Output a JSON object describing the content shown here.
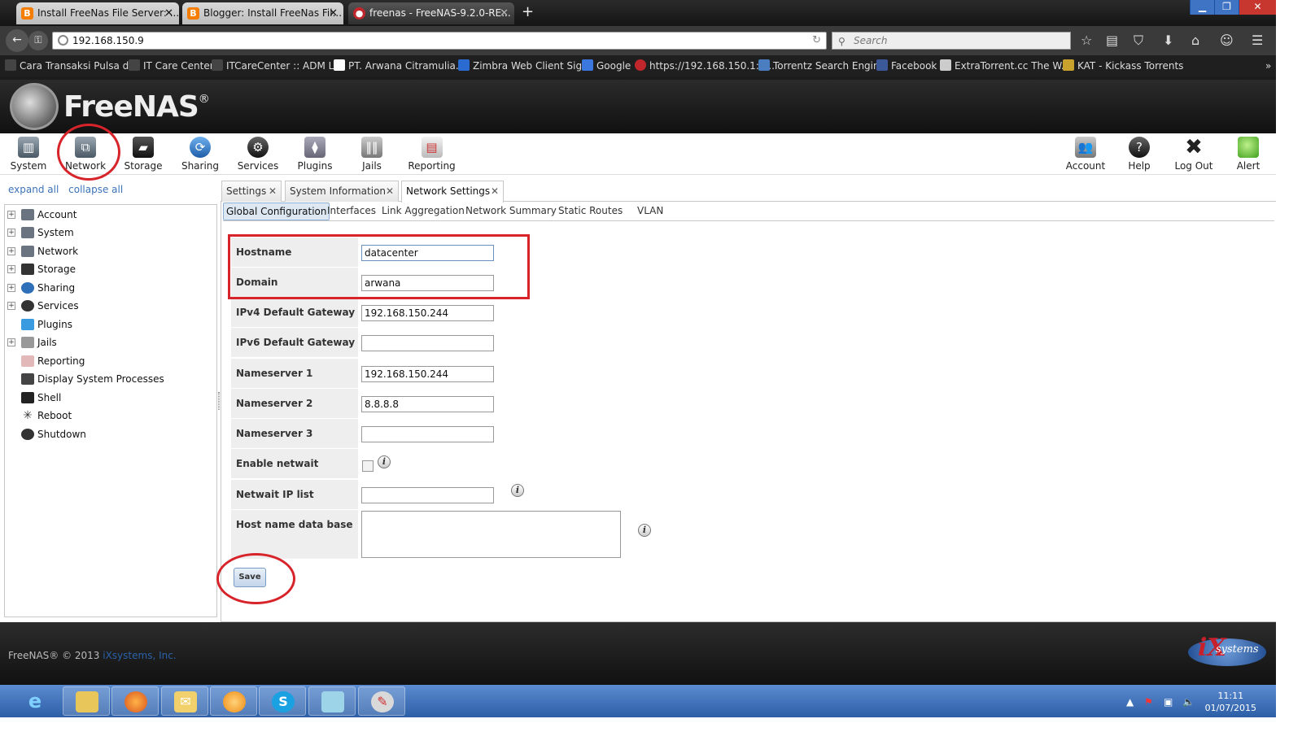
{
  "browser": {
    "tabs": [
      {
        "label": "Install FreeNas File Server: ...",
        "favicon": "B"
      },
      {
        "label": "Blogger: Install FreeNas Fil...",
        "favicon": "B"
      },
      {
        "label": "freenas - FreeNAS-9.2.0-RE...",
        "favicon": "●"
      }
    ],
    "url": "192.168.150.9",
    "search_placeholder": "Search",
    "bookmarks": [
      "Cara Transaksi Pulsa di...",
      "IT Care Center",
      "ITCareCenter :: ADM L...",
      "PT. Arwana Citramulia...",
      "Zimbra Web Client Sig...",
      "Google",
      "https://192.168.150.1:3...",
      "Torrentz Search Engine",
      "Facebook",
      "ExtraTorrent.cc The W...",
      "KAT - Kickass Torrents"
    ]
  },
  "app": {
    "logo_text": "FreeNAS",
    "logo_mark": "®"
  },
  "toolbar": {
    "left": [
      "System",
      "Network",
      "Storage",
      "Sharing",
      "Services",
      "Plugins",
      "Jails",
      "Reporting"
    ],
    "right": [
      "Account",
      "Help",
      "Log Out",
      "Alert"
    ]
  },
  "tree": {
    "expand_all": "expand all",
    "collapse_all": "collapse all",
    "items": [
      {
        "label": "Account",
        "expandable": true
      },
      {
        "label": "System",
        "expandable": true
      },
      {
        "label": "Network",
        "expandable": true
      },
      {
        "label": "Storage",
        "expandable": true
      },
      {
        "label": "Sharing",
        "expandable": true
      },
      {
        "label": "Services",
        "expandable": true
      },
      {
        "label": "Plugins",
        "expandable": false
      },
      {
        "label": "Jails",
        "expandable": true
      },
      {
        "label": "Reporting",
        "expandable": false
      },
      {
        "label": "Display System Processes",
        "expandable": false
      },
      {
        "label": "Shell",
        "expandable": false
      },
      {
        "label": "Reboot",
        "expandable": false
      },
      {
        "label": "Shutdown",
        "expandable": false
      }
    ]
  },
  "content_tabs": [
    "Settings",
    "System Information",
    "Network Settings"
  ],
  "active_content_tab": "Network Settings",
  "subtabs": [
    "Global Configuration",
    "Interfaces",
    "Link Aggregation",
    "Network Summary",
    "Static Routes",
    "VLAN"
  ],
  "active_subtab": "Global Configuration",
  "form": {
    "hostname_label": "Hostname",
    "hostname_value": "datacenter",
    "domain_label": "Domain",
    "domain_value": "arwana",
    "ipv4_gateway_label": "IPv4 Default Gateway",
    "ipv4_gateway_value": "192.168.150.244",
    "ipv6_gateway_label": "IPv6 Default Gateway",
    "ipv6_gateway_value": "",
    "ns1_label": "Nameserver 1",
    "ns1_value": "192.168.150.244",
    "ns2_label": "Nameserver 2",
    "ns2_value": "8.8.8.8",
    "ns3_label": "Nameserver 3",
    "ns3_value": "",
    "netwait_enable_label": "Enable netwait feature",
    "netwait_enable_checked": false,
    "netwait_ip_label": "Netwait IP list",
    "netwait_ip_value": "",
    "hostdb_label": "Host name data base",
    "hostdb_value": "",
    "save_label": "Save"
  },
  "footer": {
    "copyright": "FreeNAS® © 2013 ",
    "company_link": "iXsystems, Inc.",
    "ix_logo_text": "systems",
    "ix_logo_mark": "iX"
  },
  "taskbar": {
    "time": "11:11",
    "date": "01/07/2015"
  },
  "colors": {
    "annotation_red": "#d7242a",
    "link_blue": "#3b73b9",
    "taskbar_blue": "#2d5fa8"
  }
}
